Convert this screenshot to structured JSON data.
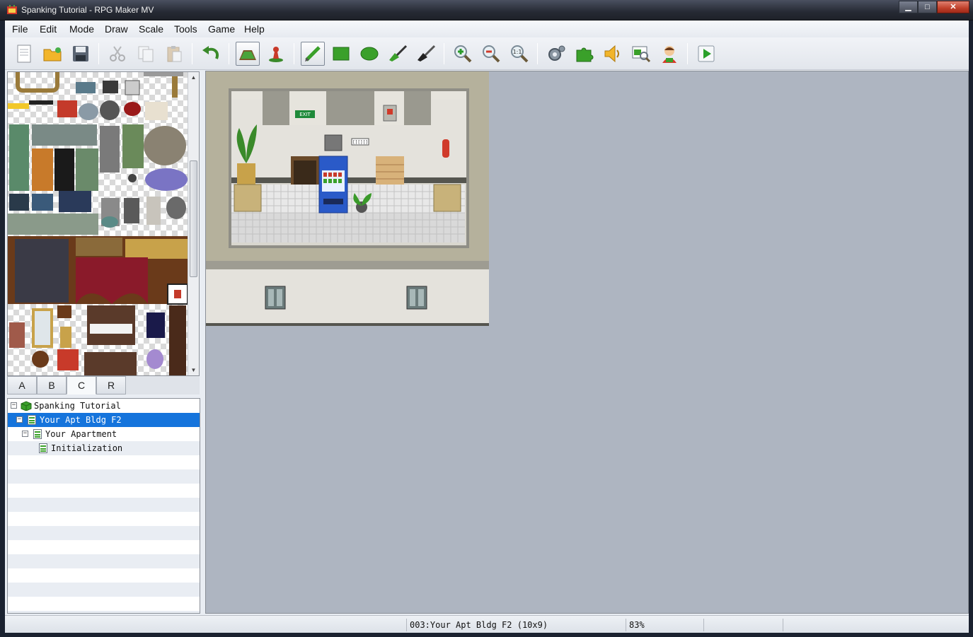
{
  "window": {
    "title": "Spanking Tutorial - RPG Maker MV",
    "controls": {
      "minimize": "▁",
      "maximize": "□",
      "close": "✕"
    }
  },
  "menu": [
    "File",
    "Edit",
    "Mode",
    "Draw",
    "Scale",
    "Tools",
    "Game",
    "Help"
  ],
  "toolbar": [
    {
      "icon": "new-project-icon",
      "active": false
    },
    {
      "icon": "open-project-icon",
      "active": false
    },
    {
      "icon": "save-project-icon",
      "active": false
    },
    {
      "icon": "cut-icon",
      "active": false
    },
    {
      "icon": "copy-icon",
      "active": false
    },
    {
      "icon": "paste-icon",
      "active": false
    },
    {
      "icon": "undo-icon",
      "active": false
    },
    {
      "icon": "map-mode-icon",
      "active": true
    },
    {
      "icon": "event-mode-icon",
      "active": false
    },
    {
      "icon": "pencil-icon",
      "active": true
    },
    {
      "icon": "rectangle-icon",
      "active": false
    },
    {
      "icon": "ellipse-icon",
      "active": false
    },
    {
      "icon": "flood-fill-icon",
      "active": false
    },
    {
      "icon": "shadow-pen-icon",
      "active": false
    },
    {
      "icon": "zoom-in-icon",
      "active": false
    },
    {
      "icon": "zoom-out-icon",
      "active": false
    },
    {
      "icon": "actual-size-icon",
      "active": false
    },
    {
      "icon": "database-icon",
      "active": false
    },
    {
      "icon": "plugin-manager-icon",
      "active": false
    },
    {
      "icon": "sound-test-icon",
      "active": false
    },
    {
      "icon": "event-searcher-icon",
      "active": false
    },
    {
      "icon": "character-generator-icon",
      "active": false
    },
    {
      "icon": "playtest-icon",
      "active": false
    }
  ],
  "zoom_actual_label": "1:1",
  "tileset_tabs": [
    {
      "label": "A",
      "selected": false
    },
    {
      "label": "B",
      "selected": false
    },
    {
      "label": "C",
      "selected": true
    },
    {
      "label": "R",
      "selected": false
    }
  ],
  "map_tree": [
    {
      "label": "Spanking Tutorial",
      "level": 0,
      "type": "project",
      "selected": false,
      "expander": "−"
    },
    {
      "label": "Your Apt Bldg F2",
      "level": 1,
      "type": "map",
      "selected": true,
      "expander": "−"
    },
    {
      "label": "Your Apartment",
      "level": 2,
      "type": "map",
      "selected": false,
      "expander": "−"
    },
    {
      "label": "Initialization",
      "level": 3,
      "type": "map",
      "selected": false,
      "expander": ""
    }
  ],
  "map_signs": {
    "exit": "EXIT",
    "plate": "[][][]"
  },
  "status": {
    "map": "003:Your Apt Bldg F2 (10x9)",
    "zoom": "83%"
  },
  "colors": {
    "selection": "#1574dc",
    "canvas_bg": "#aeb5c1",
    "wall": "#e4e2dc",
    "floor": "#e8e8e8"
  }
}
